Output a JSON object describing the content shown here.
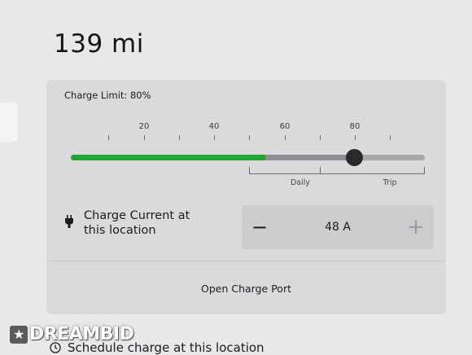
{
  "range": {
    "value": "139 mi"
  },
  "charge_limit": {
    "label": "Charge Limit: 80%",
    "value_percent": 80,
    "tick_labels": [
      "20",
      "40",
      "60",
      "80"
    ],
    "daily_label": "Daily",
    "trip_label": "Trip"
  },
  "charge_current": {
    "label": "Charge Current at this location",
    "value": "48 A",
    "decrement": "−",
    "increment": "+",
    "icon": "plug-icon"
  },
  "charge_port": {
    "label": "Open Charge Port"
  },
  "schedule": {
    "label": "Schedule charge at this location",
    "icon": "clock-icon"
  },
  "watermark": {
    "text": "DREAMBID"
  },
  "colors": {
    "accent_green": "#20a432",
    "background": "#e9e7ea",
    "panel": "#dcd9dc"
  }
}
